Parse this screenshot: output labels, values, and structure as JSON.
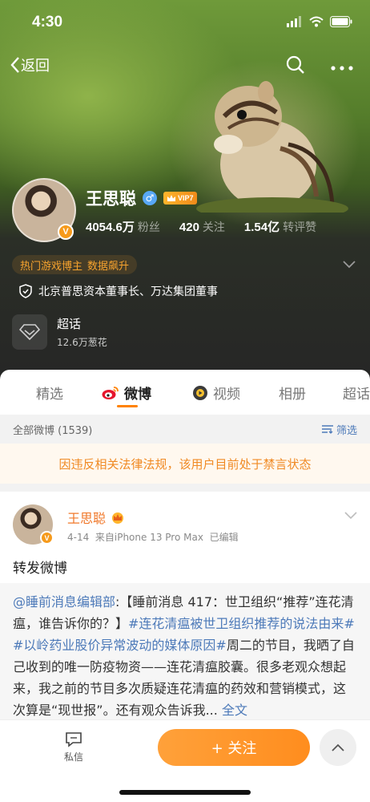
{
  "status_bar": {
    "time": "4:30"
  },
  "nav": {
    "back_label": "返回"
  },
  "profile": {
    "name": "王思聪",
    "gender_symbol": "♂",
    "vip_label": "VIP7",
    "verified_symbol": "V",
    "stats": [
      {
        "value": "4054.6万",
        "label": "粉丝"
      },
      {
        "value": "420",
        "label": "关注"
      },
      {
        "value": "1.54亿",
        "label": "转评赞"
      }
    ],
    "hot_tag": {
      "part1": "热门游戏博主",
      "part2": "数据飙升"
    },
    "verification": "北京普思资本董事长、万达集团董事",
    "chaohua": {
      "title": "超话",
      "subtitle": "12.6万葱花"
    }
  },
  "tabs": [
    {
      "label": "精选"
    },
    {
      "label": "微博"
    },
    {
      "label": "视频"
    },
    {
      "label": "相册"
    },
    {
      "label": "超话"
    }
  ],
  "filter_bar": {
    "count_text": "全部微博 (1539)",
    "filter_label": "筛选"
  },
  "ban_notice": "因违反相关法律法规，该用户目前处于禁言状态",
  "post": {
    "author": "王思聪",
    "date": "4-14",
    "source": "来自iPhone 13 Pro Max",
    "edited": "已编辑",
    "text": "转发微博",
    "repost": {
      "mention": "@睡前消息编辑部",
      "colon": ":",
      "text1": "【睡前消息 417：世卫组织“推荐”连花清瘟，谁告诉你的？】",
      "hashtag1": "#连花清瘟被世卫组织推荐的说法由来#",
      "hashtag2": "#以岭药业股价异常波动的媒体原因#",
      "text2": "周二的节目，我晒了自己收到的唯一防疫物资——连花清瘟胶囊。很多老观众想起来，我之前的节目多次质疑连花清瘟的药效和营销模式，这次算是“现世报”。",
      "text3": "还有观众告诉我...",
      "full_text_link": "全文"
    }
  },
  "bottom_bar": {
    "dm_label": "私信",
    "follow_label": "+ 关注"
  },
  "colors": {
    "accent_orange": "#ff8200",
    "link_blue": "#4d7ab9",
    "notice_orange": "#f08a24"
  }
}
